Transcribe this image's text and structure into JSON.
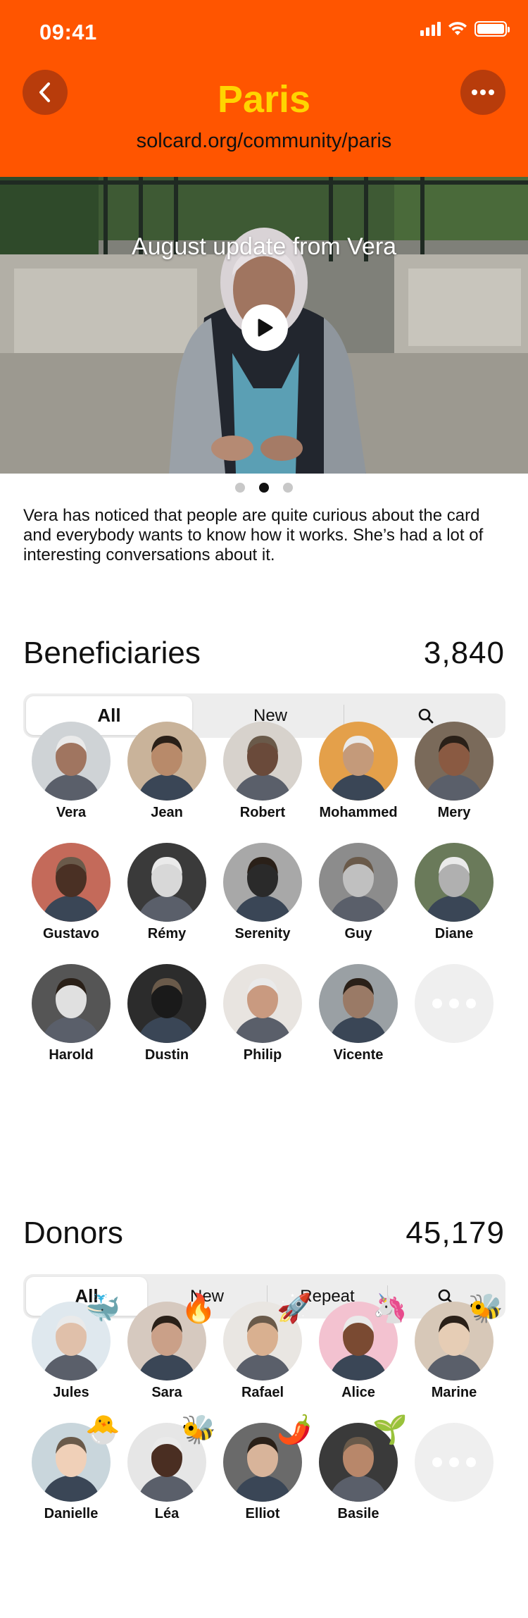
{
  "status": {
    "time": "09:41"
  },
  "header": {
    "title": "Paris",
    "url": "solcard.org/community/paris",
    "back_icon": "chevron-left-icon",
    "more_icon": "more-horizontal-icon",
    "bg_color": "#FF5500",
    "title_color": "#FFD500"
  },
  "hero": {
    "title": "August update from Vera",
    "play_icon": "play-icon",
    "slides": 3,
    "active_slide": 2
  },
  "description": "Vera has noticed that people are quite curious about the card and everybody wants to know how it works. She’s had a lot of interesting conversations about it.",
  "beneficiaries": {
    "title": "Beneficiaries",
    "count": "3,840",
    "tabs": [
      "All",
      "New"
    ],
    "search_icon": "search-icon",
    "people": [
      {
        "name": "Vera"
      },
      {
        "name": "Jean"
      },
      {
        "name": "Robert"
      },
      {
        "name": "Mohammed"
      },
      {
        "name": "Mery"
      },
      {
        "name": "Gustavo"
      },
      {
        "name": "Rémy"
      },
      {
        "name": "Serenity"
      },
      {
        "name": "Guy"
      },
      {
        "name": "Diane"
      },
      {
        "name": "Harold"
      },
      {
        "name": "Dustin"
      },
      {
        "name": "Philip"
      },
      {
        "name": "Vicente"
      }
    ]
  },
  "donors": {
    "title": "Donors",
    "count": "45,179",
    "tabs": [
      "All",
      "New",
      "Repeat"
    ],
    "search_icon": "search-icon",
    "people": [
      {
        "name": "Jules",
        "emoji": "🐳"
      },
      {
        "name": "Sara",
        "emoji": "🔥"
      },
      {
        "name": "Rafael",
        "emoji": "🚀"
      },
      {
        "name": "Alice",
        "emoji": "🦄"
      },
      {
        "name": "Marine",
        "emoji": "🐝"
      },
      {
        "name": "Danielle",
        "emoji": "🐣"
      },
      {
        "name": "Léa",
        "emoji": "🐝"
      },
      {
        "name": "Elliot",
        "emoji": "🌶️"
      },
      {
        "name": "Basile",
        "emoji": "🌱"
      }
    ]
  }
}
